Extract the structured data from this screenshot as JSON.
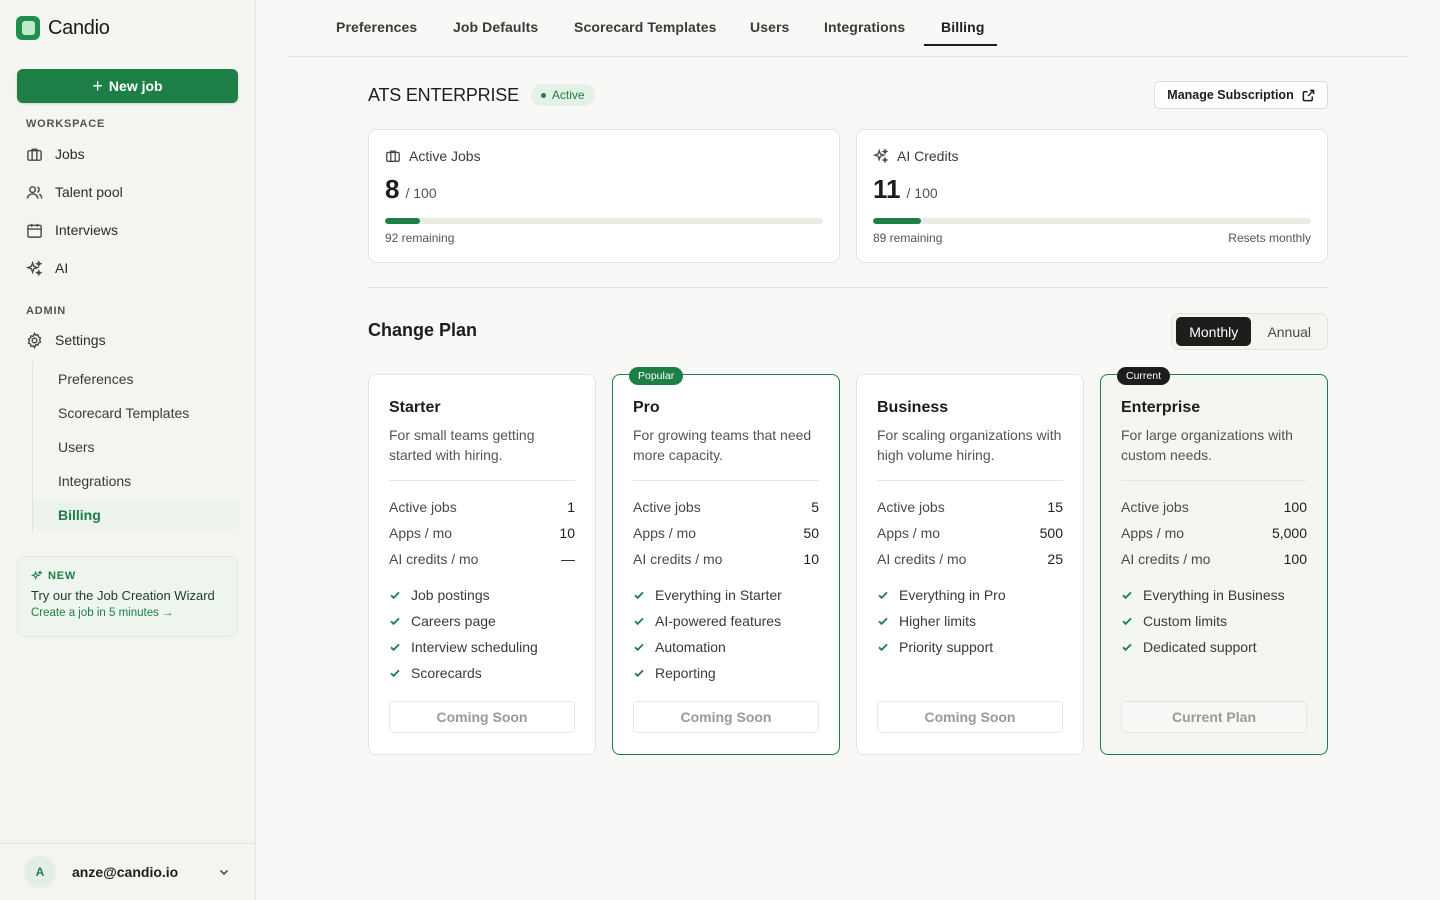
{
  "app": {
    "name": "Candio"
  },
  "sidebar": {
    "new_job_label": "New job",
    "workspace_label": "WORKSPACE",
    "workspace_items": [
      {
        "label": "Jobs",
        "icon": "briefcase-icon"
      },
      {
        "label": "Talent pool",
        "icon": "users-icon"
      },
      {
        "label": "Interviews",
        "icon": "calendar-icon"
      },
      {
        "label": "AI",
        "icon": "sparkles-icon"
      }
    ],
    "admin_label": "ADMIN",
    "settings_label": "Settings",
    "settings_items": [
      "Preferences",
      "Scorecard Templates",
      "Users",
      "Integrations",
      "Billing"
    ],
    "active_settings_item": "Billing",
    "promo": {
      "tag": "NEW",
      "title": "Try our the Job Creation Wizard",
      "link": "Create a job in 5 minutes →"
    },
    "user": {
      "initial": "A",
      "email": "anze@candio.io"
    }
  },
  "tabs": [
    "Preferences",
    "Job Defaults",
    "Scorecard Templates",
    "Users",
    "Integrations",
    "Billing"
  ],
  "active_tab": "Billing",
  "subscription": {
    "plan_name": "ATS ENTERPRISE",
    "status": "Active",
    "manage_label": "Manage Subscription"
  },
  "usage": [
    {
      "label": "Active Jobs",
      "value": "8",
      "max": "/ 100",
      "fraction": 0.08,
      "remaining": "92 remaining",
      "note": ""
    },
    {
      "label": "AI Credits",
      "value": "11",
      "max": "/ 100",
      "fraction": 0.11,
      "remaining": "89 remaining",
      "note": "Resets monthly"
    }
  ],
  "change_plan": {
    "title": "Change Plan",
    "billing_options": [
      "Monthly",
      "Annual"
    ],
    "selected_billing": "Monthly",
    "limit_labels": [
      "Active jobs",
      "Apps / mo",
      "AI credits / mo"
    ],
    "plans": [
      {
        "name": "Starter",
        "badge": "",
        "description": "For small teams getting started with hiring.",
        "limits": [
          "1",
          "10",
          "—"
        ],
        "features": [
          "Job postings",
          "Careers page",
          "Interview scheduling",
          "Scorecards"
        ],
        "button": "Coming Soon"
      },
      {
        "name": "Pro",
        "badge": "Popular",
        "description": "For growing teams that need more capacity.",
        "limits": [
          "5",
          "50",
          "10"
        ],
        "features": [
          "Everything in Starter",
          "AI-powered features",
          "Automation",
          "Reporting"
        ],
        "button": "Coming Soon"
      },
      {
        "name": "Business",
        "badge": "",
        "description": "For scaling organizations with high volume hiring.",
        "limits": [
          "15",
          "500",
          "25"
        ],
        "features": [
          "Everything in Pro",
          "Higher limits",
          "Priority support"
        ],
        "button": "Coming Soon"
      },
      {
        "name": "Enterprise",
        "badge": "Current",
        "description": "For large organizations with custom needs.",
        "limits": [
          "100",
          "5,000",
          "100"
        ],
        "features": [
          "Everything in Business",
          "Custom limits",
          "Dedicated support"
        ],
        "button": "Current Plan"
      }
    ]
  },
  "colors": {
    "accent": "#1d7f45",
    "dark": "#1d1d1b",
    "background": "#f8f8f6"
  }
}
